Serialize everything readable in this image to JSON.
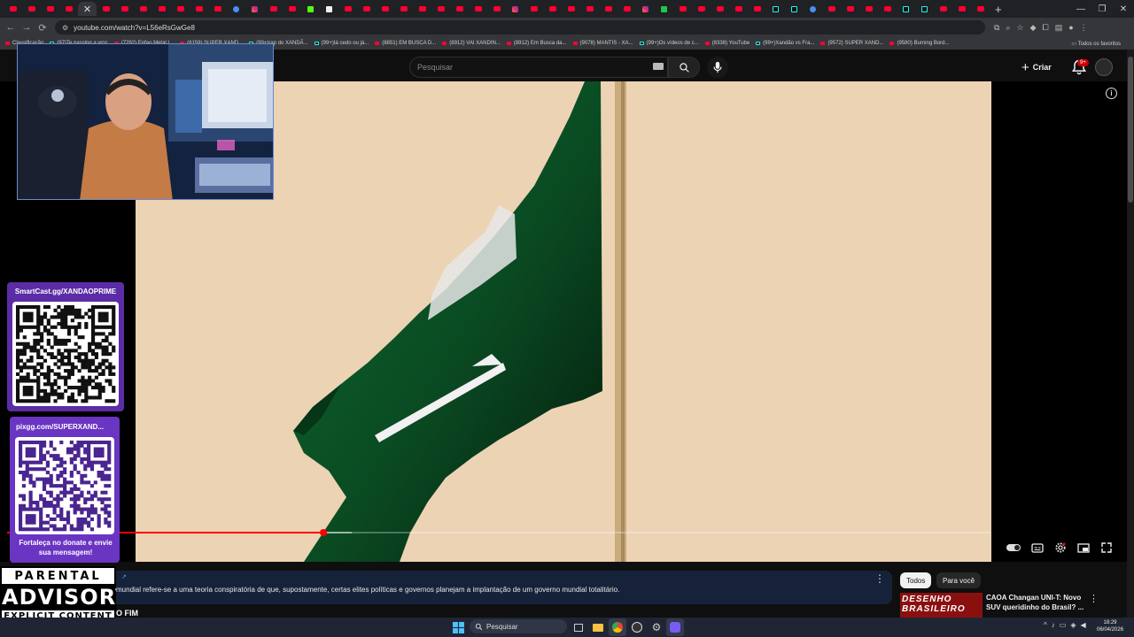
{
  "browser": {
    "url": "youtube.com/watch?v=L56eRsGwGe8",
    "tabs": [
      "yt",
      "yt",
      "yt",
      "yt",
      "yt",
      "yt",
      "yt",
      "yt",
      "yt",
      "yt",
      "yt",
      "yt",
      "bl",
      "ig",
      "yt",
      "yt",
      "kk",
      "wh",
      "yt",
      "yt",
      "yt",
      "yt",
      "yt",
      "yt",
      "yt",
      "yt",
      "yt",
      "ig",
      "yt",
      "yt",
      "yt",
      "yt",
      "yt",
      "yt",
      "ig",
      "gr",
      "yt",
      "yt",
      "yt",
      "yt",
      "yt",
      "tk",
      "tk",
      "bl",
      "yt",
      "yt",
      "yt",
      "yt",
      "tk",
      "tk",
      "yt",
      "yt",
      "yt"
    ],
    "bookmarks": [
      {
        "label": "Classificação",
        "type": "yt"
      },
      {
        "label": "(97)Te passing a vroc",
        "type": "tk"
      },
      {
        "label": "(7292) Enfao Metal I...",
        "type": "yt"
      },
      {
        "label": "(8159) SUPER XAND...",
        "type": "yt"
      },
      {
        "label": "(99+)rap do XANDÃ...",
        "type": "tk"
      },
      {
        "label": "(99+)tá cedo ou já...",
        "type": "tk"
      },
      {
        "label": "(8851) EM BUSCA D...",
        "type": "yt"
      },
      {
        "label": "(8912) VAI XANDIN...",
        "type": "yt"
      },
      {
        "label": "(8912) Em Busca da...",
        "type": "yt"
      },
      {
        "label": "(9078) MANTIS - XA...",
        "type": "yt"
      },
      {
        "label": "(99+)Os vídeos de c...",
        "type": "tk"
      },
      {
        "label": "(8338) YouTube",
        "type": "yt"
      },
      {
        "label": "(99+)Xandão vs Fra...",
        "type": "tk"
      },
      {
        "label": "(9572) SUPER XAND...",
        "type": "yt"
      },
      {
        "label": "(9580) Burning Bord...",
        "type": "yt"
      }
    ],
    "all_bookmarks_label": "Todos os favoritos"
  },
  "youtube": {
    "search_placeholder": "Pesquisar",
    "create_label": "Criar",
    "notifications_badge": "9+",
    "progress": {
      "played": 0.322,
      "buffered": 0.35
    },
    "description_link": "↗",
    "description_text": "mundial refere-se a uma teoria conspiratória de que, supostamente, certas elites políticas e governos planejam a implantação de um governo mundial totalitário.",
    "video_title_partial": "O FIM",
    "chips": [
      "Todos",
      "Para você"
    ],
    "recommended": {
      "thumb_text": "DESENHO BRASILEIRO",
      "title": "CAOA Changan UNI-T: Novo SUV queridinho do Brasil? ..."
    }
  },
  "overlay": {
    "qr1_title": "SmartCast.gg/XANDAOPRIME",
    "qr2_title": "pixgg.com/SUPERXAND...",
    "qr2_bottom": "Fortaleça no donate e envie sua mensagem!",
    "advisory_l1": "PARENTAL",
    "advisory_l2": "ADVISORY",
    "advisory_l3": "EXPLICIT CONTENT"
  },
  "taskbar": {
    "search_label": "Pesquisar",
    "time": "18:29",
    "date": "06/04/2026"
  },
  "colors": {
    "accent": "#ff0000",
    "flag_green": "#0b5a2a",
    "frame_bg": "#ecd3b4"
  }
}
